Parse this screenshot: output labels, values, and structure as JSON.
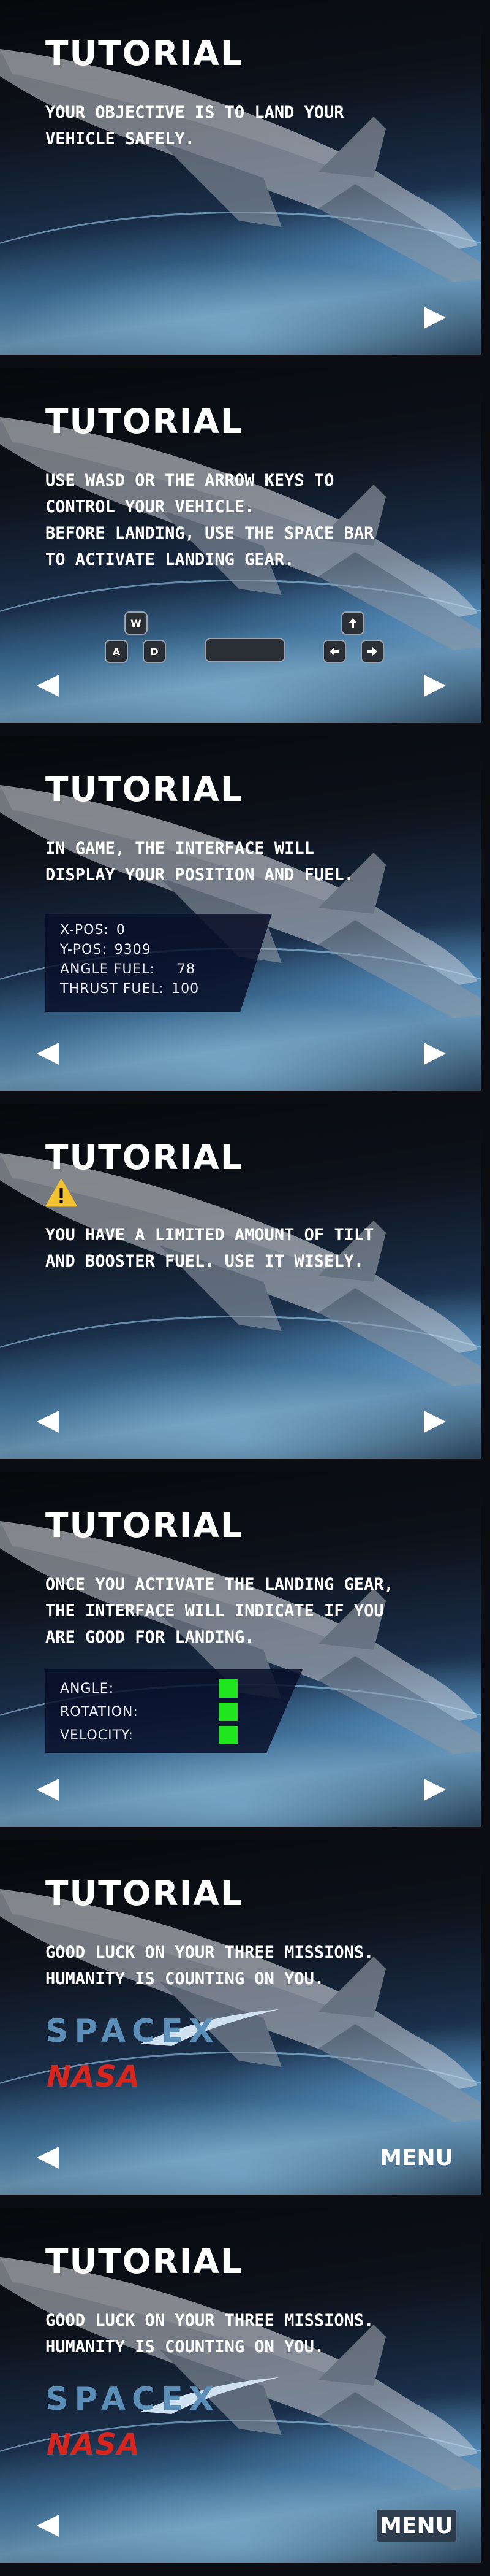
{
  "colors": {
    "accent_green": "#1ee51e",
    "spacex_blue": "#5c8fb8",
    "nasa_red": "#d7261e",
    "hud_bg": "#080e28"
  },
  "panels": [
    {
      "title": "TUTORIAL",
      "lines": [
        "YOUR OBJECTIVE IS TO LAND YOUR",
        "VEHICLE SAFELY."
      ],
      "nav": {
        "left": false,
        "right": true
      }
    },
    {
      "title": "TUTORIAL",
      "lines": [
        "USE WASD OR THE ARROW KEYS TO",
        "CONTROL YOUR VEHICLE.",
        "BEFORE LANDING, USE THE SPACE BAR",
        "TO ACTIVATE LANDING GEAR."
      ],
      "keys": {
        "w": "W",
        "a": "A",
        "d": "D"
      },
      "nav": {
        "left": true,
        "right": true
      }
    },
    {
      "title": "TUTORIAL",
      "lines": [
        "IN GAME, THE INTERFACE WILL",
        "DISPLAY YOUR POSITION AND FUEL."
      ],
      "hud": [
        {
          "label": "X-POS:",
          "value": "0"
        },
        {
          "label": "Y-POS:",
          "value": "9309"
        },
        {
          "label": "ANGLE FUEL:",
          "value": "78"
        },
        {
          "label": "THRUST FUEL:",
          "value": "100"
        }
      ],
      "nav": {
        "left": true,
        "right": true
      }
    },
    {
      "title": "TUTORIAL",
      "lines": [
        "YOU HAVE A LIMITED AMOUNT OF TILT",
        "AND BOOSTER FUEL. USE IT WISELY."
      ],
      "warning_icon": "warning-icon",
      "nav": {
        "left": true,
        "right": true
      }
    },
    {
      "title": "TUTORIAL",
      "lines": [
        "ONCE YOU ACTIVATE THE LANDING GEAR,",
        "THE INTERFACE WILL INDICATE IF YOU",
        "ARE GOOD FOR LANDING."
      ],
      "indicators": [
        {
          "label": "ANGLE:"
        },
        {
          "label": "ROTATION:"
        },
        {
          "label": "VELOCITY:"
        }
      ],
      "nav": {
        "left": true,
        "right": true
      }
    },
    {
      "title": "TUTORIAL",
      "lines": [
        "GOOD LUCK ON YOUR THREE MISSIONS.",
        "HUMANITY IS COUNTING ON YOU."
      ],
      "logos": {
        "spacex": "SPACEX",
        "nasa": "NASA"
      },
      "menu_label": "MENU",
      "nav": {
        "left": true,
        "right": false
      }
    },
    {
      "title": "TUTORIAL",
      "lines": [
        "GOOD LUCK ON YOUR THREE MISSIONS.",
        "HUMANITY IS COUNTING ON YOU."
      ],
      "logos": {
        "spacex": "SPACEX",
        "nasa": "NASA"
      },
      "menu_label": "MENU",
      "nav": {
        "left": true,
        "right": false
      }
    }
  ]
}
